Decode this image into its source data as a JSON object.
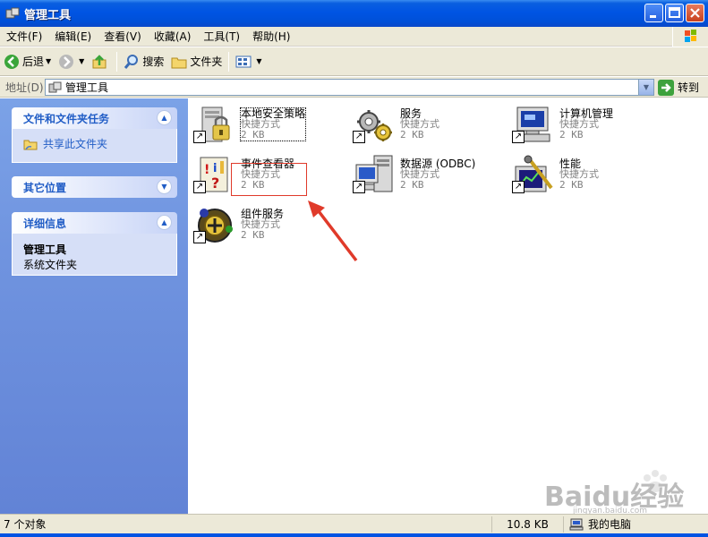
{
  "window": {
    "title": "管理工具"
  },
  "menu": [
    "文件(F)",
    "编辑(E)",
    "查看(V)",
    "收藏(A)",
    "工具(T)",
    "帮助(H)"
  ],
  "toolbar": {
    "back": "后退",
    "search": "搜索",
    "folders": "文件夹"
  },
  "address": {
    "label": "地址(D)",
    "value": "管理工具",
    "go": "转到"
  },
  "tasks": {
    "file_tasks": {
      "title": "文件和文件夹任务",
      "items": [
        "共享此文件夹"
      ]
    },
    "other_places": {
      "title": "其它位置"
    },
    "details": {
      "title": "详细信息",
      "name": "管理工具",
      "type": "系统文件夹"
    }
  },
  "items": [
    {
      "name": "本地安全策略",
      "type": "快捷方式",
      "size": "2 KB",
      "icon": "local-security-policy-icon"
    },
    {
      "name": "服务",
      "type": "快捷方式",
      "size": "2 KB",
      "icon": "services-icon"
    },
    {
      "name": "计算机管理",
      "type": "快捷方式",
      "size": "2 KB",
      "icon": "computer-management-icon"
    },
    {
      "name": "事件查看器",
      "type": "快捷方式",
      "size": "2 KB",
      "icon": "event-viewer-icon"
    },
    {
      "name": "数据源 (ODBC)",
      "type": "快捷方式",
      "size": "2 KB",
      "icon": "odbc-data-source-icon"
    },
    {
      "name": "性能",
      "type": "快捷方式",
      "size": "2 KB",
      "icon": "performance-icon"
    },
    {
      "name": "组件服务",
      "type": "快捷方式",
      "size": "2 KB",
      "icon": "component-services-icon"
    }
  ],
  "status": {
    "count": "7 个对象",
    "size": "10.8 KB",
    "zone": "我的电脑"
  },
  "watermark": {
    "text": "Baidu经验",
    "sub": "jingyan.baidu.com"
  },
  "colors": {
    "title_blue": "#0054e3",
    "pane_blue": "#6f93df",
    "highlight_red": "#e03a2a"
  }
}
